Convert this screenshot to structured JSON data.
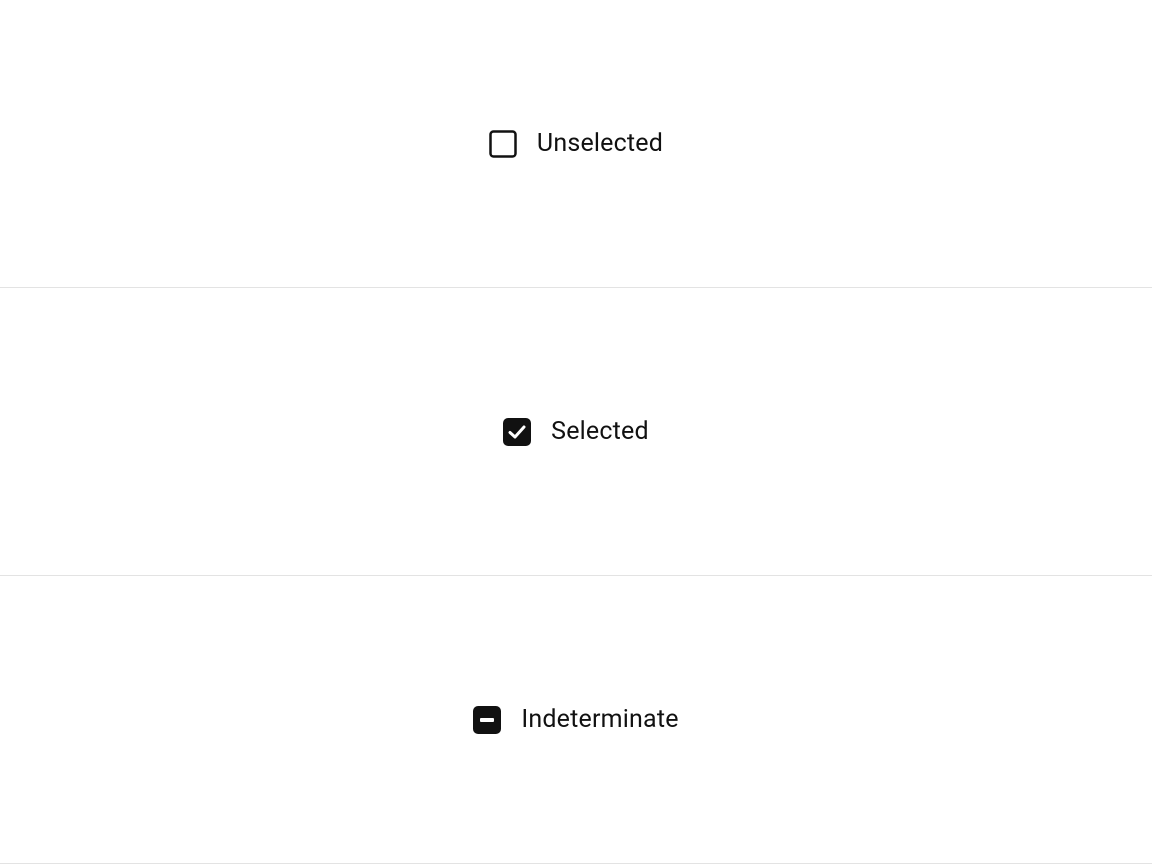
{
  "checkboxes": [
    {
      "state": "unselected",
      "label": "Unselected"
    },
    {
      "state": "selected",
      "label": "Selected"
    },
    {
      "state": "indeterminate",
      "label": "Indeterminate"
    }
  ]
}
